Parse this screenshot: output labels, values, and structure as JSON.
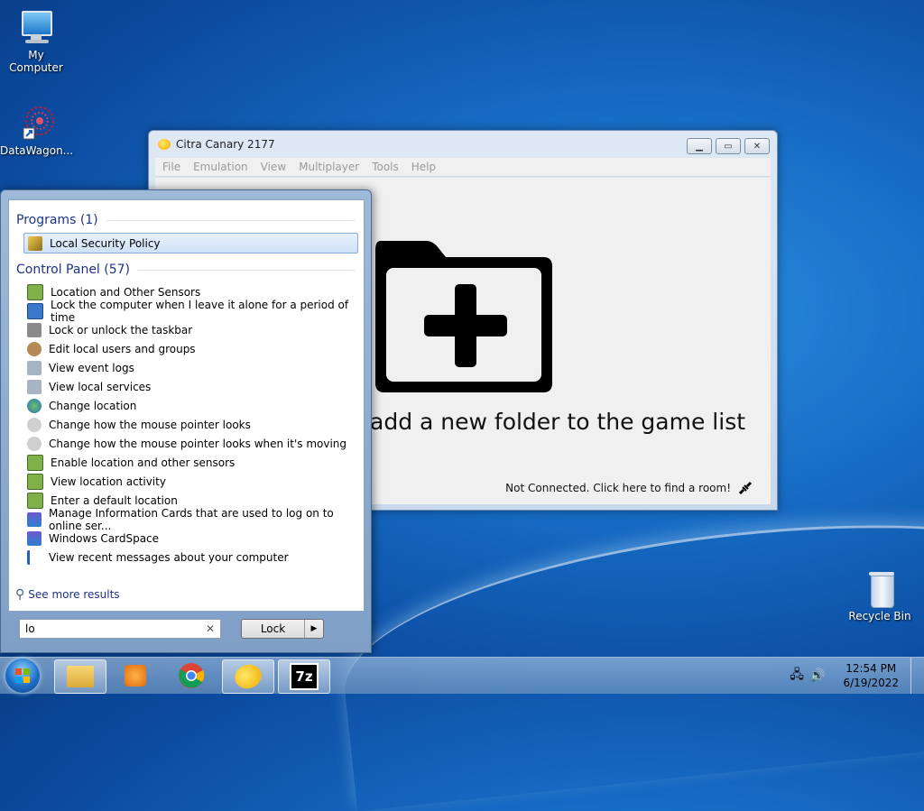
{
  "desktop": {
    "icons": [
      {
        "label": "My Computer"
      },
      {
        "label": "DataWagon..."
      },
      {
        "label": "Recycle Bin"
      }
    ]
  },
  "citra": {
    "title": "Citra Canary 2177",
    "menu": [
      "File",
      "Emulation",
      "View",
      "Multiplayer",
      "Tools",
      "Help"
    ],
    "game_list_message": "add a new folder to the game list",
    "status_text": "Not Connected. Click here to find a room!"
  },
  "start_menu": {
    "programs_header": "Programs (1)",
    "programs": [
      "Local Security Policy"
    ],
    "control_panel_header": "Control Panel (57)",
    "control_panel_items": [
      "Location and Other Sensors",
      "Lock the computer when I leave it alone for a period of time",
      "Lock or unlock the taskbar",
      "Edit local users and groups",
      "View event logs",
      "View local services",
      "Change location",
      "Change how the mouse pointer looks",
      "Change how the mouse pointer looks when it's moving",
      "Enable location and other sensors",
      "View location activity",
      "Enter a default location",
      "Manage Information Cards that are used to log on to online ser...",
      "Windows CardSpace",
      "View recent messages about your computer"
    ],
    "see_more": "See more results",
    "search_value": "lo",
    "shutdown_label": "Lock"
  },
  "taskbar": {
    "time": "12:54 PM",
    "date": "6/19/2022",
    "pinned": [
      "file-explorer-icon",
      "media-player-icon",
      "chrome-icon",
      "citra-icon",
      "7zip-icon"
    ]
  }
}
